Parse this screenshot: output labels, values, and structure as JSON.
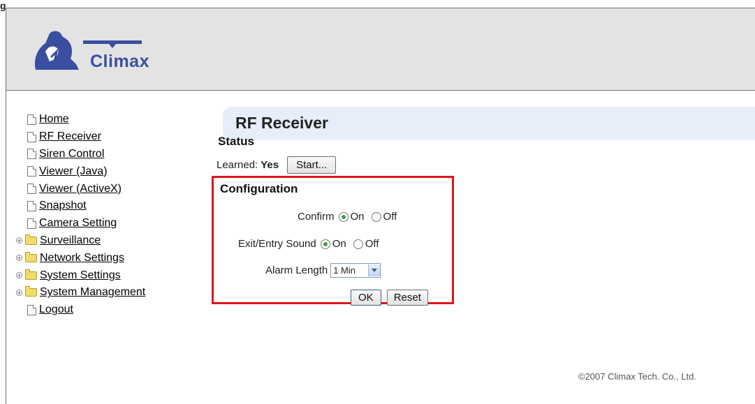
{
  "figure_label": "g",
  "logo": {
    "text": "Climax"
  },
  "nav": {
    "items": [
      {
        "label": "Home",
        "type": "doc"
      },
      {
        "label": "RF Receiver",
        "type": "doc"
      },
      {
        "label": "Siren Control",
        "type": "doc"
      },
      {
        "label": "Viewer (Java)",
        "type": "doc"
      },
      {
        "label": "Viewer (ActiveX)",
        "type": "doc"
      },
      {
        "label": "Snapshot",
        "type": "doc"
      },
      {
        "label": "Camera Setting",
        "type": "doc"
      },
      {
        "label": "Surveillance",
        "type": "folder"
      },
      {
        "label": "Network Settings",
        "type": "folder"
      },
      {
        "label": "System Settings",
        "type": "folder"
      },
      {
        "label": "System Management",
        "type": "folder"
      },
      {
        "label": "Logout",
        "type": "doc"
      }
    ]
  },
  "page": {
    "title": "RF Receiver"
  },
  "status": {
    "heading": "Status",
    "learned_label": "Learned:",
    "learned_value": "Yes",
    "start_button": "Start..."
  },
  "config": {
    "heading": "Configuration",
    "confirm_label": "Confirm",
    "exit_entry_label": "Exit/Entry Sound",
    "on_label": "On",
    "off_label": "Off",
    "confirm_value": "On",
    "exit_entry_value": "On",
    "alarm_length_label": "Alarm Length",
    "alarm_length_value": "1 Min",
    "ok_button": "OK",
    "reset_button": "Reset"
  },
  "footer": {
    "copyright": "©2007 Climax Tech. Co., Ltd."
  },
  "colors": {
    "highlight_border": "#e3141c",
    "banner_bg": "#e7eef9",
    "radio_on": "#37a638"
  }
}
